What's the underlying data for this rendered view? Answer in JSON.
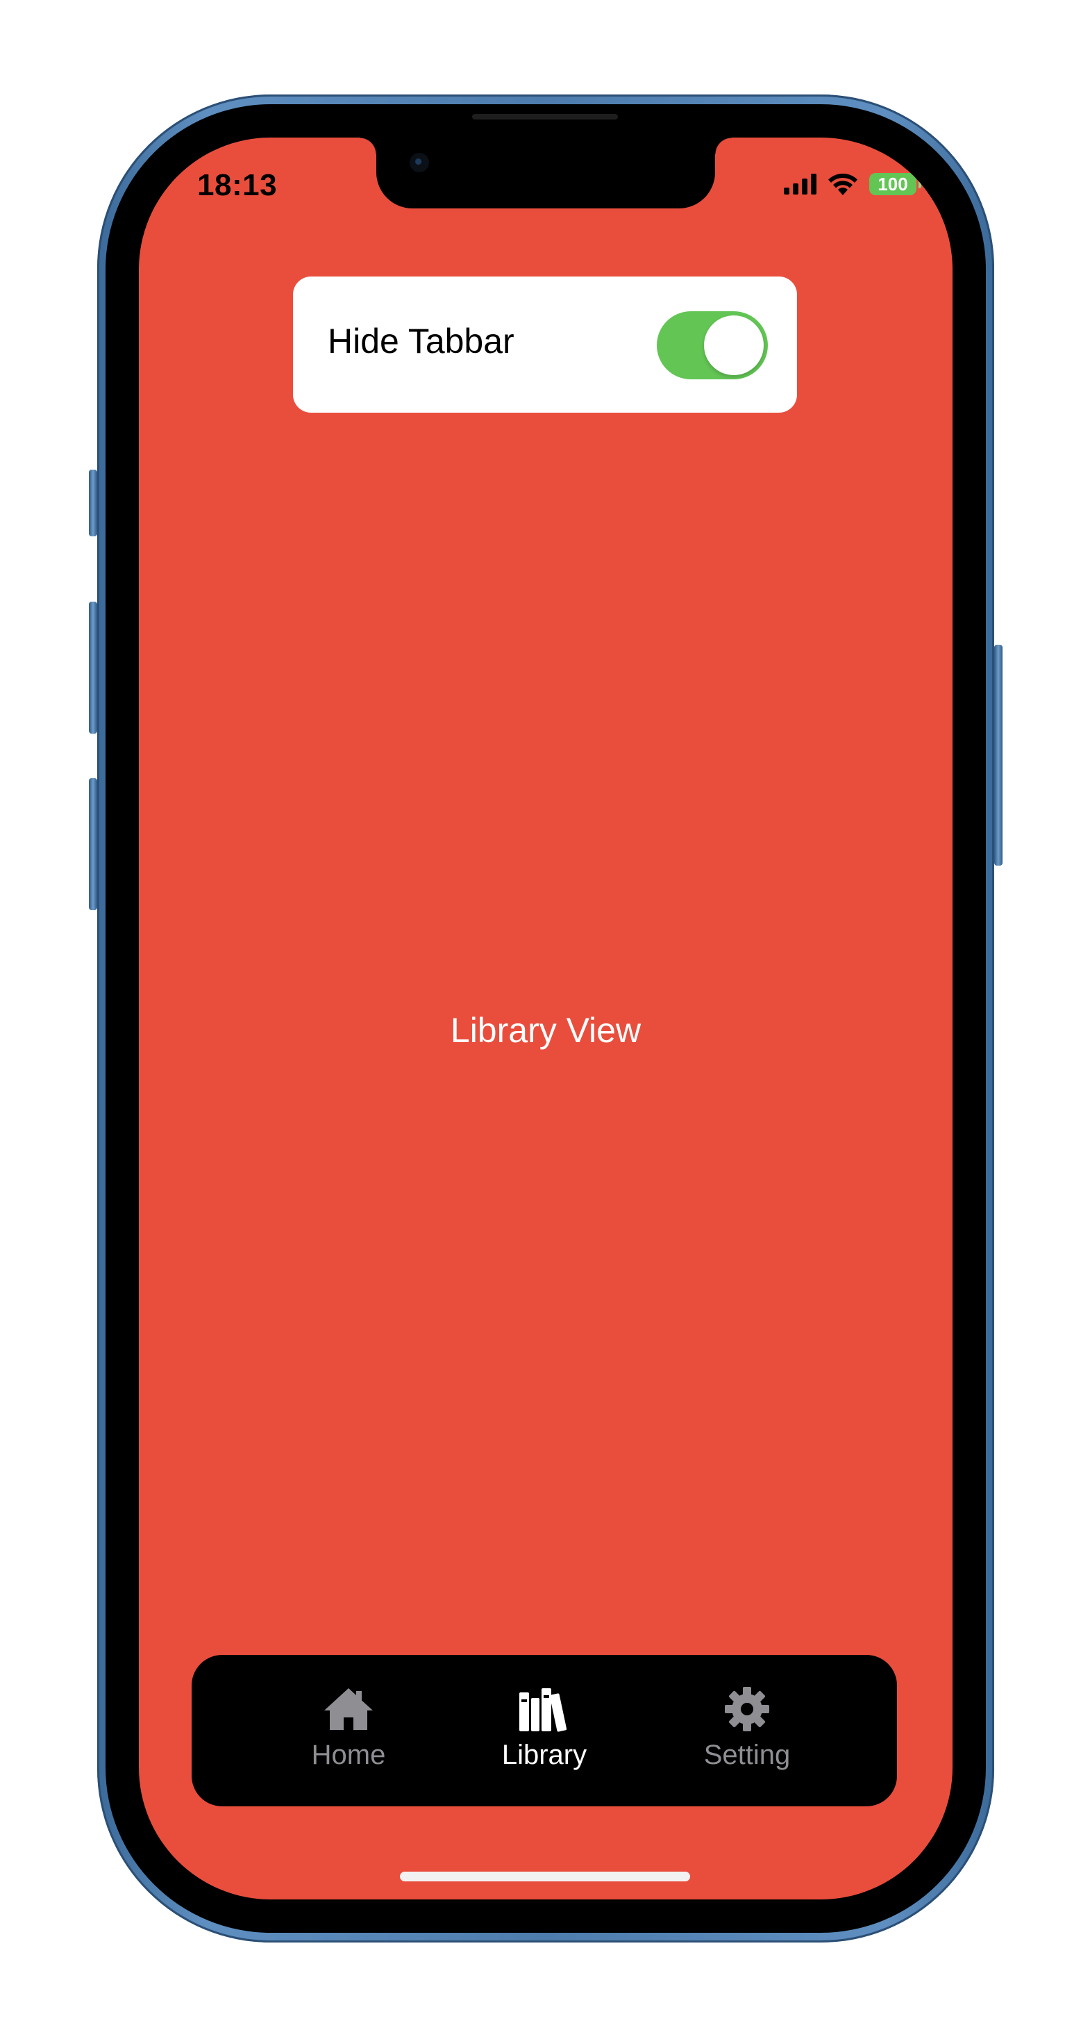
{
  "status_bar": {
    "time": "18:13",
    "battery_level": "100",
    "signal_icon": "cellular-signal-icon",
    "wifi_icon": "wifi-icon"
  },
  "toggle_card": {
    "label": "Hide Tabbar",
    "is_on": true
  },
  "main": {
    "title": "Library View"
  },
  "tabbar": {
    "items": [
      {
        "label": "Home",
        "icon": "house-icon",
        "selected": false
      },
      {
        "label": "Library",
        "icon": "books-icon",
        "selected": true
      },
      {
        "label": "Setting",
        "icon": "gear-icon",
        "selected": false
      }
    ]
  },
  "colors": {
    "background": "#e94e3d",
    "switch_on": "#62c554",
    "tabbar_background": "#000000",
    "tab_selected": "#ffffff",
    "tab_unselected": "#8e8e93"
  }
}
